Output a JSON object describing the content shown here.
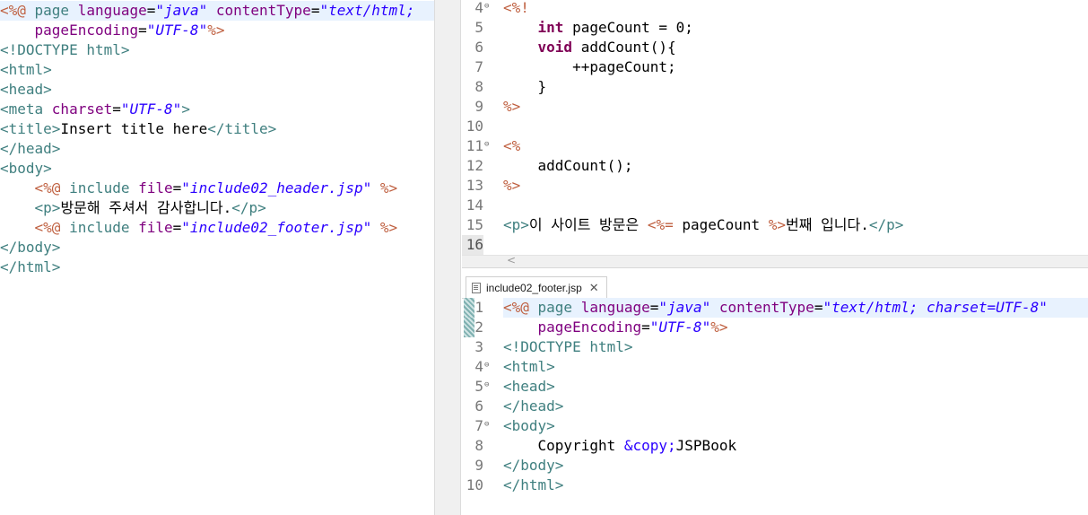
{
  "left_editor": {
    "lines": [
      [
        [
          "d",
          "<%@ "
        ],
        [
          "t",
          "page "
        ],
        [
          "a",
          "language"
        ],
        [
          "x",
          "="
        ],
        [
          "v",
          "\"java\""
        ],
        [
          "x",
          " "
        ],
        [
          "a",
          "contentType"
        ],
        [
          "x",
          "="
        ],
        [
          "v",
          "\"text/html;"
        ]
      ],
      [
        [
          "x",
          "    "
        ],
        [
          "a",
          "pageEncoding"
        ],
        [
          "x",
          "="
        ],
        [
          "v",
          "\"UTF-8\""
        ],
        [
          "d",
          "%>"
        ]
      ],
      [
        [
          "t",
          "<!DOCTYPE html>"
        ]
      ],
      [
        [
          "t",
          "<html>"
        ]
      ],
      [
        [
          "t",
          "<head>"
        ]
      ],
      [
        [
          "t",
          "<meta "
        ],
        [
          "a",
          "charset"
        ],
        [
          "x",
          "="
        ],
        [
          "v",
          "\"UTF-8\""
        ],
        [
          "t",
          ">"
        ]
      ],
      [
        [
          "t",
          "<title>"
        ],
        [
          "x",
          "Insert title here"
        ],
        [
          "t",
          "</title>"
        ]
      ],
      [
        [
          "t",
          "</head>"
        ]
      ],
      [
        [
          "t",
          "<body>"
        ]
      ],
      [
        [
          "x",
          "    "
        ],
        [
          "d",
          "<%@ "
        ],
        [
          "t",
          "include "
        ],
        [
          "a",
          "file"
        ],
        [
          "x",
          "="
        ],
        [
          "v",
          "\"include02_header.jsp\""
        ],
        [
          "x",
          " "
        ],
        [
          "d",
          "%>"
        ]
      ],
      [
        [
          "x",
          "    "
        ],
        [
          "t",
          "<p>"
        ],
        [
          "x",
          "방문해 주셔서 감사합니다."
        ],
        [
          "t",
          "</p>"
        ]
      ],
      [
        [
          "x",
          "    "
        ],
        [
          "d",
          "<%@ "
        ],
        [
          "t",
          "include "
        ],
        [
          "a",
          "file"
        ],
        [
          "x",
          "="
        ],
        [
          "v",
          "\"include02_footer.jsp\""
        ],
        [
          "x",
          " "
        ],
        [
          "d",
          "%>"
        ]
      ],
      [
        [
          "t",
          "</body>"
        ]
      ],
      [
        [
          "t",
          "</html>"
        ]
      ]
    ]
  },
  "top_right_editor": {
    "lines": [
      {
        "num": "4",
        "fold": true,
        "tokens": [
          [
            "d",
            "<%!"
          ]
        ]
      },
      {
        "num": "5",
        "fold": false,
        "tokens": [
          [
            "x",
            "    "
          ],
          [
            "k",
            "int"
          ],
          [
            "x",
            " pageCount = 0;"
          ]
        ]
      },
      {
        "num": "6",
        "fold": false,
        "tokens": [
          [
            "x",
            "    "
          ],
          [
            "k",
            "void"
          ],
          [
            "x",
            " addCount(){"
          ]
        ]
      },
      {
        "num": "7",
        "fold": false,
        "tokens": [
          [
            "x",
            "        ++pageCount;"
          ]
        ]
      },
      {
        "num": "8",
        "fold": false,
        "tokens": [
          [
            "x",
            "    }"
          ]
        ]
      },
      {
        "num": "9",
        "fold": false,
        "tokens": [
          [
            "d",
            "%>"
          ]
        ]
      },
      {
        "num": "10",
        "fold": false,
        "tokens": []
      },
      {
        "num": "11",
        "fold": true,
        "tokens": [
          [
            "d",
            "<%"
          ]
        ]
      },
      {
        "num": "12",
        "fold": false,
        "tokens": [
          [
            "x",
            "    addCount();"
          ]
        ]
      },
      {
        "num": "13",
        "fold": false,
        "tokens": [
          [
            "d",
            "%>"
          ]
        ]
      },
      {
        "num": "14",
        "fold": false,
        "tokens": []
      },
      {
        "num": "15",
        "fold": false,
        "tokens": [
          [
            "t",
            "<p>"
          ],
          [
            "x",
            "이 사이트 방문은 "
          ],
          [
            "d",
            "<%="
          ],
          [
            "x",
            " pageCount "
          ],
          [
            "d",
            "%>"
          ],
          [
            "x",
            "번째 입니다."
          ],
          [
            "t",
            "</p>"
          ]
        ]
      },
      {
        "num": "16",
        "fold": false,
        "tokens": []
      }
    ]
  },
  "hscroll": {
    "arrow": "<"
  },
  "tab": {
    "label": "include02_footer.jsp",
    "close": "✕"
  },
  "bottom_right_editor": {
    "lines": [
      {
        "num": "1",
        "fold": false,
        "tokens": [
          [
            "d",
            "<%@ "
          ],
          [
            "t",
            "page "
          ],
          [
            "a",
            "language"
          ],
          [
            "x",
            "="
          ],
          [
            "v",
            "\"java\""
          ],
          [
            "x",
            " "
          ],
          [
            "a",
            "contentType"
          ],
          [
            "x",
            "="
          ],
          [
            "v",
            "\"text/html; charset=UTF-8\""
          ]
        ]
      },
      {
        "num": "2",
        "fold": false,
        "tokens": [
          [
            "x",
            "    "
          ],
          [
            "a",
            "pageEncoding"
          ],
          [
            "x",
            "="
          ],
          [
            "v",
            "\"UTF-8\""
          ],
          [
            "d",
            "%>"
          ]
        ]
      },
      {
        "num": "3",
        "fold": false,
        "tokens": [
          [
            "t",
            "<!DOCTYPE html>"
          ]
        ]
      },
      {
        "num": "4",
        "fold": true,
        "tokens": [
          [
            "t",
            "<html>"
          ]
        ]
      },
      {
        "num": "5",
        "fold": true,
        "tokens": [
          [
            "t",
            "<head>"
          ]
        ]
      },
      {
        "num": "6",
        "fold": false,
        "tokens": [
          [
            "t",
            "</head>"
          ]
        ]
      },
      {
        "num": "7",
        "fold": true,
        "tokens": [
          [
            "t",
            "<body>"
          ]
        ]
      },
      {
        "num": "8",
        "fold": false,
        "tokens": [
          [
            "x",
            "    Copyright "
          ],
          [
            "e",
            "&copy;"
          ],
          [
            "x",
            "JSPBook"
          ]
        ]
      },
      {
        "num": "9",
        "fold": false,
        "tokens": [
          [
            "t",
            "</body>"
          ]
        ]
      },
      {
        "num": "10",
        "fold": false,
        "tokens": [
          [
            "t",
            "</html>"
          ]
        ]
      }
    ]
  }
}
